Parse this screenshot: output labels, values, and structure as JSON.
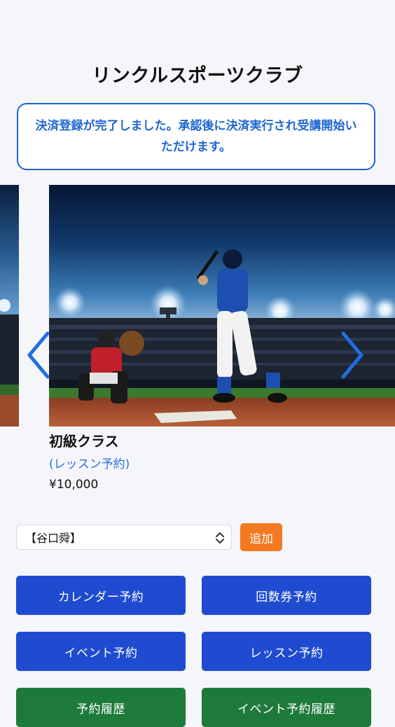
{
  "header": {
    "title": "リンクルスポーツクラブ"
  },
  "notice": {
    "message": "決済登録が完了しました。承認後に決済実行され受講開始いただけます。"
  },
  "carousel": {
    "prev_icon": "chevron-left-icon",
    "next_icon": "chevron-right-icon",
    "image": "baseball-stadium-photo"
  },
  "course": {
    "name": "初級クラス",
    "link_label": "(レッスン予約)",
    "price": "¥10,000"
  },
  "member_select": {
    "selected": "【谷口舜】",
    "add_label": "追加"
  },
  "actions": {
    "calendar": "カレンダー予約",
    "ticket": "回数券予約",
    "event": "イベント予約",
    "lesson": "レッスン予約",
    "history": "予約履歴",
    "event_history": "イベント予約履歴"
  },
  "colors": {
    "primary_blue": "#1f4bd0",
    "green": "#1e7a3a",
    "orange": "#f47a22",
    "notice_blue": "#1e66d0"
  }
}
